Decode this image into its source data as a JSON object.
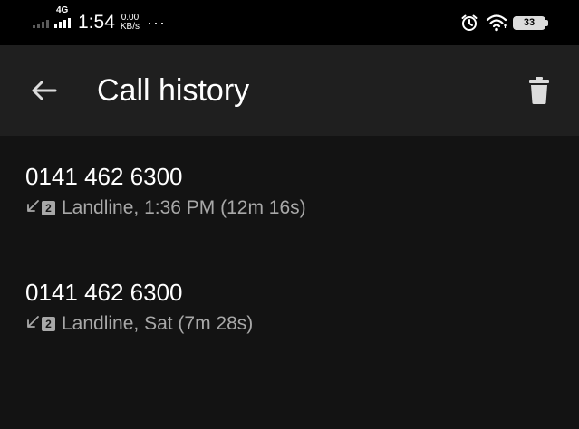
{
  "status_bar": {
    "network_type": "4G",
    "time": "1:54",
    "speed_value": "0.00",
    "speed_unit": "KB/s",
    "more_dots": "···",
    "battery_level": "33",
    "icons": [
      "signal-icon",
      "alarm-icon",
      "wifi-icon",
      "battery-icon"
    ]
  },
  "app_bar": {
    "title": "Call history",
    "back_icon": "arrow-left-icon",
    "delete_icon": "trash-icon"
  },
  "calls": [
    {
      "number": "0141 462 6300",
      "direction_icon": "incoming-call-icon",
      "sim": "2",
      "detail": "Landline, 1:36 PM (12m 16s)"
    },
    {
      "number": "0141 462 6300",
      "direction_icon": "incoming-call-icon",
      "sim": "2",
      "detail": "Landline, Sat (7m 28s)"
    }
  ],
  "colors": {
    "status_bar_bg": "#000000",
    "app_bar_bg": "#1f1f1f",
    "page_bg": "#131313",
    "primary_text": "#ffffff",
    "secondary_text": "#a8a8a8"
  }
}
